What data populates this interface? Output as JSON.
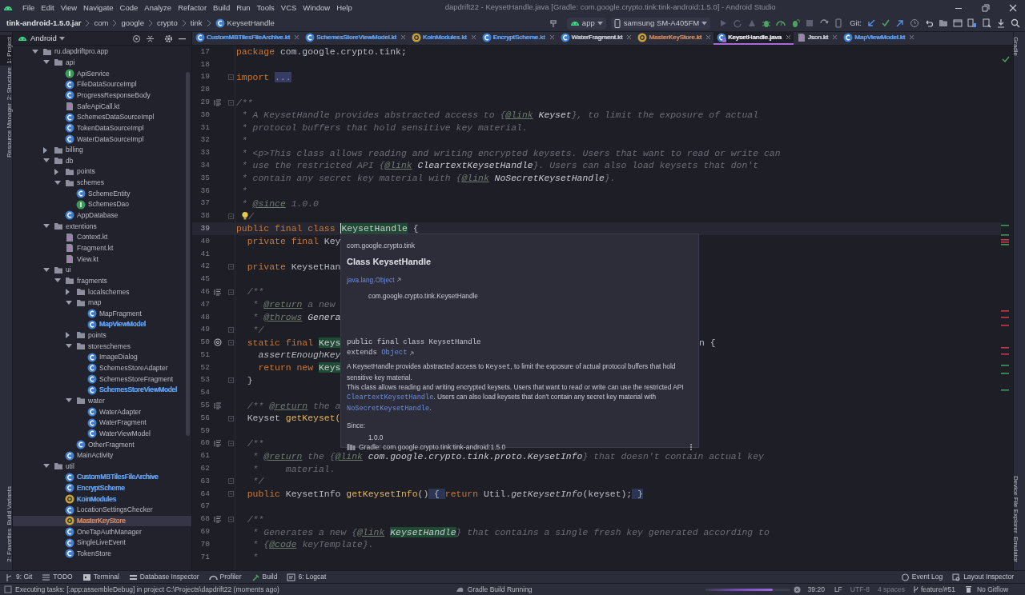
{
  "menu": [
    "File",
    "Edit",
    "View",
    "Navigate",
    "Code",
    "Analyze",
    "Refactor",
    "Build",
    "Run",
    "Tools",
    "VCS",
    "Window",
    "Help"
  ],
  "window_title": "dapdrift22 - KeysetHandle.java [Gradle: com.google.crypto.tink:tink-android:1.5.0] - Android Studio",
  "breadcrumbs": [
    {
      "label": "tink-android-1.5.0.jar",
      "kind": "jar"
    },
    {
      "label": "com",
      "kind": "package"
    },
    {
      "label": "google",
      "kind": "package"
    },
    {
      "label": "crypto",
      "kind": "package"
    },
    {
      "label": "tink",
      "kind": "package"
    },
    {
      "label": "KeysetHandle",
      "kind": "class"
    }
  ],
  "toolbar": {
    "run_config": "app",
    "device": "samsung SM-A405FM",
    "vcs_label": "Git:"
  },
  "left_strip": {
    "top": [
      {
        "label": "1: Project",
        "selected": true
      },
      {
        "label": "2: Structure",
        "selected": false
      },
      {
        "label": "Resource Manager",
        "selected": false
      }
    ],
    "bottom": [
      {
        "label": "Build Variants",
        "selected": false
      },
      {
        "label": "2: Favorites",
        "selected": false
      }
    ]
  },
  "right_strip": {
    "top": [
      {
        "label": "Gradle"
      }
    ],
    "bottom": [
      {
        "label": "Device File Explorer"
      },
      {
        "label": "Emulator"
      }
    ]
  },
  "project_panel": {
    "view": "Android",
    "tree": [
      {
        "label": "ru.dapdriftpro.app",
        "kind": "package",
        "expanded": true,
        "selected": false,
        "children": [
          {
            "label": "api",
            "kind": "package",
            "expanded": true,
            "selected": false,
            "children": [
              {
                "label": "ApiService",
                "kind": "interface",
                "selected": false
              },
              {
                "label": "FileDataSourceImpl",
                "kind": "class",
                "selected": false
              },
              {
                "label": "ProgressResponseBody",
                "kind": "class",
                "selected": false
              },
              {
                "label": "SafeApiCall.kt",
                "kind": "kotlin-file",
                "selected": false
              },
              {
                "label": "SchemesDataSourceImpl",
                "kind": "class",
                "selected": false
              },
              {
                "label": "TokenDataSourceImpl",
                "kind": "class",
                "selected": false
              },
              {
                "label": "WaterDataSourceImpl",
                "kind": "class",
                "selected": false
              }
            ]
          },
          {
            "label": "billing",
            "kind": "package",
            "expanded": false,
            "selected": false
          },
          {
            "label": "db",
            "kind": "package",
            "expanded": true,
            "selected": false,
            "children": [
              {
                "label": "points",
                "kind": "package",
                "expanded": false,
                "selected": false
              },
              {
                "label": "schemes",
                "kind": "package",
                "expanded": true,
                "selected": false,
                "children": [
                  {
                    "label": "SchemeEntity",
                    "kind": "class",
                    "selected": false
                  },
                  {
                    "label": "SchemesDao",
                    "kind": "interface",
                    "selected": false
                  }
                ]
              },
              {
                "label": "AppDatabase",
                "kind": "class",
                "selected": false
              }
            ]
          },
          {
            "label": "extentions",
            "kind": "package",
            "expanded": true,
            "selected": false,
            "children": [
              {
                "label": "Context.kt",
                "kind": "kotlin-file",
                "selected": false
              },
              {
                "label": "Fragment.kt",
                "kind": "kotlin-file",
                "selected": false
              },
              {
                "label": "View.kt",
                "kind": "kotlin-file",
                "selected": false
              }
            ]
          },
          {
            "label": "ui",
            "kind": "package",
            "expanded": true,
            "selected": false,
            "children": [
              {
                "label": "fragments",
                "kind": "package",
                "expanded": true,
                "selected": false,
                "children": [
                  {
                    "label": "localschemes",
                    "kind": "package",
                    "expanded": false,
                    "selected": false
                  },
                  {
                    "label": "map",
                    "kind": "package",
                    "expanded": true,
                    "selected": false,
                    "children": [
                      {
                        "label": "MapFragment",
                        "kind": "class",
                        "selected": false
                      },
                      {
                        "label": "MapViewModel",
                        "kind": "class",
                        "color": "#5e9ff0",
                        "selected": false
                      }
                    ]
                  },
                  {
                    "label": "points",
                    "kind": "package",
                    "expanded": false,
                    "selected": false
                  },
                  {
                    "label": "storeschemes",
                    "kind": "package",
                    "expanded": true,
                    "selected": false,
                    "children": [
                      {
                        "label": "ImageDialog",
                        "kind": "class",
                        "selected": false
                      },
                      {
                        "label": "SchemesStoreAdapter",
                        "kind": "class",
                        "selected": false
                      },
                      {
                        "label": "SchemesStoreFragment",
                        "kind": "class",
                        "selected": false
                      },
                      {
                        "label": "SchemesStoreViewModel",
                        "kind": "class",
                        "color": "#5e9ff0",
                        "selected": false
                      }
                    ]
                  },
                  {
                    "label": "water",
                    "kind": "package",
                    "expanded": true,
                    "selected": false,
                    "children": [
                      {
                        "label": "WaterAdapter",
                        "kind": "class",
                        "selected": false
                      },
                      {
                        "label": "WaterFragment",
                        "kind": "class",
                        "selected": false
                      },
                      {
                        "label": "WaterViewModel",
                        "kind": "class",
                        "selected": false
                      }
                    ]
                  },
                  {
                    "label": "OtherFragment",
                    "kind": "class",
                    "selected": false
                  }
                ]
              },
              {
                "label": "MainActivity",
                "kind": "class",
                "selected": false
              }
            ]
          },
          {
            "label": "util",
            "kind": "package",
            "expanded": true,
            "selected": false,
            "children": [
              {
                "label": "CustomMBTilesFileArchive",
                "kind": "class",
                "color": "#5e9ff0",
                "selected": false
              },
              {
                "label": "EncryptScheme",
                "kind": "class",
                "color": "#5e9ff0",
                "selected": false
              },
              {
                "label": "KoinModules",
                "kind": "object",
                "color": "#5e9ff0",
                "selected": false
              },
              {
                "label": "LocationSettingsChecker",
                "kind": "class",
                "selected": false
              },
              {
                "label": "MasterKeyStore",
                "kind": "object",
                "color": "#c8845c",
                "selected": true
              },
              {
                "label": "OneTapAuthManager",
                "kind": "class",
                "selected": false
              },
              {
                "label": "SingleLiveEvent",
                "kind": "class",
                "selected": false
              },
              {
                "label": "TokenStore",
                "kind": "class",
                "selected": false
              }
            ]
          }
        ]
      }
    ]
  },
  "editor_tabs": [
    {
      "label": "CustomMBTilesFileArchive.kt",
      "kind": "class",
      "color": "#5e9ff0",
      "selected": false
    },
    {
      "label": "SchemesStoreViewModel.kt",
      "kind": "class",
      "color": "#5e9ff0",
      "selected": false
    },
    {
      "label": "KoinModules.kt",
      "kind": "object",
      "color": "#5e9ff0",
      "selected": false
    },
    {
      "label": "EncryptScheme.kt",
      "kind": "class",
      "color": "#5e9ff0",
      "selected": false
    },
    {
      "label": "WaterFragment.kt",
      "kind": "class",
      "color": "#c5c8d0",
      "selected": false
    },
    {
      "label": "MasterKeyStore.kt",
      "kind": "object",
      "color": "#c8845c",
      "selected": false
    },
    {
      "label": "KeysetHandle.java",
      "kind": "java-class",
      "color": "#dfe1e6",
      "selected": true
    },
    {
      "label": "Json.kt",
      "kind": "kotlin-file",
      "color": "#c5c8d0",
      "selected": false
    },
    {
      "label": "MapViewModel.kt",
      "kind": "class",
      "color": "#5e9ff0",
      "selected": false
    }
  ],
  "editor": {
    "lines": [
      {
        "number": "17",
        "current": false,
        "segments": [
          {
            "kind": "kw",
            "text": "package"
          },
          {
            "kind": "plain",
            "text": " com.google.crypto.tink;"
          }
        ]
      },
      {
        "number": "18",
        "current": false
      },
      {
        "number": "19",
        "current": false,
        "fold": true,
        "segments": [
          {
            "kind": "kw",
            "text": "import "
          },
          {
            "kind": "folded",
            "text": "..."
          }
        ]
      },
      {
        "number": "28",
        "current": false
      },
      {
        "number": "29",
        "current": false,
        "doc_icon": true,
        "fold": true,
        "segments": [
          {
            "kind": "comment",
            "text": "/**"
          }
        ]
      },
      {
        "number": "30",
        "current": false,
        "segments": [
          {
            "kind": "comment",
            "text": " * A KeysetHandle provides abstracted access to {"
          },
          {
            "kind": "tag",
            "text": "@link"
          },
          {
            "kind": "ref",
            "text": " Keyset"
          },
          {
            "kind": "comment",
            "text": "}, to limit the exposure of actual"
          }
        ]
      },
      {
        "number": "31",
        "current": false,
        "segments": [
          {
            "kind": "comment",
            "text": " * protocol buffers that hold sensitive key material."
          }
        ]
      },
      {
        "number": "32",
        "current": false,
        "segments": [
          {
            "kind": "comment",
            "text": " *"
          }
        ]
      },
      {
        "number": "33",
        "current": false,
        "segments": [
          {
            "kind": "comment",
            "text": " * <p>This class allows reading and writing encrypted keysets. Users that want to read or write can"
          }
        ]
      },
      {
        "number": "34",
        "current": false,
        "segments": [
          {
            "kind": "comment",
            "text": " * use the restricted API {"
          },
          {
            "kind": "tag",
            "text": "@link"
          },
          {
            "kind": "ref",
            "text": " CleartextKeysetHandle"
          },
          {
            "kind": "comment",
            "text": "}. Users can also load keysets that don't"
          }
        ]
      },
      {
        "number": "35",
        "current": false,
        "segments": [
          {
            "kind": "comment",
            "text": " * contain any secret key material with {"
          },
          {
            "kind": "tag",
            "text": "@link"
          },
          {
            "kind": "ref",
            "text": " NoSecretKeysetHandle"
          },
          {
            "kind": "comment",
            "text": "}."
          }
        ]
      },
      {
        "number": "36",
        "current": false,
        "segments": [
          {
            "kind": "comment",
            "text": " *"
          }
        ]
      },
      {
        "number": "37",
        "current": false,
        "segments": [
          {
            "kind": "comment",
            "text": " * "
          },
          {
            "kind": "tag",
            "text": "@since"
          },
          {
            "kind": "comment",
            "text": " 1.0.0"
          }
        ]
      },
      {
        "number": "38",
        "current": false,
        "fold": true,
        "segments": [
          {
            "kind": "bulb"
          },
          {
            "kind": "comment",
            "text": "/"
          }
        ]
      },
      {
        "number": "39",
        "current": true,
        "segments": [
          {
            "kind": "kw",
            "text": "public final class "
          },
          {
            "kind": "hl",
            "text": "KeysetHandle",
            "caret": true
          },
          {
            "kind": "plain",
            "text": " {"
          }
        ]
      },
      {
        "number": "40",
        "current": false,
        "segments": [
          {
            "kind": "kw",
            "text": "  private final "
          },
          {
            "kind": "plain",
            "text": "Key"
          }
        ]
      },
      {
        "number": "41",
        "current": false
      },
      {
        "number": "42",
        "current": false,
        "fold": true,
        "segments": [
          {
            "kind": "kw",
            "text": "  private "
          },
          {
            "kind": "plain",
            "text": "KeysetHan"
          }
        ]
      },
      {
        "number": "45",
        "current": false
      },
      {
        "number": "46",
        "current": false,
        "doc_icon": true,
        "fold": true,
        "segments": [
          {
            "kind": "comment",
            "text": "  /**"
          }
        ]
      },
      {
        "number": "47",
        "current": false,
        "segments": [
          {
            "kind": "comment",
            "text": "   * "
          },
          {
            "kind": "tag",
            "text": "@return"
          },
          {
            "kind": "comment",
            "text": " a new"
          }
        ]
      },
      {
        "number": "48",
        "current": false,
        "segments": [
          {
            "kind": "comment",
            "text": "   * "
          },
          {
            "kind": "tag",
            "text": "@throws"
          },
          {
            "kind": "ref",
            "text": " Genera"
          }
        ]
      },
      {
        "number": "49",
        "current": false,
        "fold": true,
        "segments": [
          {
            "kind": "comment",
            "text": "   */"
          }
        ]
      },
      {
        "number": "50",
        "current": false,
        "override_icon": true,
        "fold": true,
        "segments": [
          {
            "kind": "kw",
            "text": "  static final "
          },
          {
            "kind": "hl",
            "text": "Keys"
          }
        ],
        "after_popup": [
          {
            "kind": "plain",
            "text": "n {"
          }
        ]
      },
      {
        "number": "51",
        "current": false,
        "segments": [
          {
            "kind": "ifn",
            "text": "    assertEnoughKey"
          }
        ]
      },
      {
        "number": "52",
        "current": false,
        "segments": [
          {
            "kind": "kw",
            "text": "    return new "
          },
          {
            "kind": "hl",
            "text": "Keys"
          }
        ]
      },
      {
        "number": "53",
        "current": false,
        "fold": true,
        "segments": [
          {
            "kind": "plain",
            "text": "  }"
          }
        ]
      },
      {
        "number": "54",
        "current": false
      },
      {
        "number": "55",
        "current": false,
        "doc_icon": true,
        "segments": [
          {
            "kind": "comment",
            "text": "  /** "
          },
          {
            "kind": "tag",
            "text": "@return"
          },
          {
            "kind": "comment",
            "text": " the a"
          }
        ]
      },
      {
        "number": "56",
        "current": false,
        "fold": true,
        "segments": [
          {
            "kind": "plain",
            "text": "  Keyset "
          },
          {
            "kind": "fn",
            "text": "getKeyset("
          }
        ]
      },
      {
        "number": "59",
        "current": false
      },
      {
        "number": "60",
        "current": false,
        "doc_icon": true,
        "fold": true,
        "segments": [
          {
            "kind": "comment",
            "text": "  /**"
          }
        ]
      },
      {
        "number": "61",
        "current": false,
        "segments": [
          {
            "kind": "comment",
            "text": "   * "
          },
          {
            "kind": "tag",
            "text": "@return"
          },
          {
            "kind": "comment",
            "text": " the {"
          },
          {
            "kind": "tag",
            "text": "@link"
          },
          {
            "kind": "ref",
            "text": " com.google.crypto.tink.proto.KeysetInfo"
          },
          {
            "kind": "comment",
            "text": "} that doesn't contain actual key"
          }
        ]
      },
      {
        "number": "62",
        "current": false,
        "segments": [
          {
            "kind": "comment",
            "text": "   *     material."
          }
        ]
      },
      {
        "number": "63",
        "current": false,
        "fold": true,
        "segments": [
          {
            "kind": "comment",
            "text": "   */"
          }
        ]
      },
      {
        "number": "64",
        "current": false,
        "fold": true,
        "segments": [
          {
            "kind": "kw",
            "text": "  public "
          },
          {
            "kind": "plain",
            "text": "KeysetInfo "
          },
          {
            "kind": "fn",
            "text": "getKeysetInfo"
          },
          {
            "kind": "plain",
            "text": "()"
          },
          {
            "kind": "brace",
            "text": " { "
          },
          {
            "kind": "kw",
            "text": "return "
          },
          {
            "kind": "plain",
            "text": "Util."
          },
          {
            "kind": "ifn",
            "text": "getKeysetInfo"
          },
          {
            "kind": "plain",
            "text": "(keyset);"
          },
          {
            "kind": "brace",
            "text": " }"
          }
        ]
      },
      {
        "number": "67",
        "current": false
      },
      {
        "number": "68",
        "current": false,
        "doc_icon": true,
        "fold": true,
        "segments": [
          {
            "kind": "comment",
            "text": "  /**"
          }
        ]
      },
      {
        "number": "69",
        "current": false,
        "segments": [
          {
            "kind": "comment",
            "text": "   * Generates a new {"
          },
          {
            "kind": "tag",
            "text": "@link"
          },
          {
            "kind": "hlref",
            "text": "KeysetHandle"
          },
          {
            "kind": "comment",
            "text": "} that contains a single fresh key generated according to"
          }
        ]
      },
      {
        "number": "70",
        "current": false,
        "segments": [
          {
            "kind": "comment",
            "text": "   * {"
          },
          {
            "kind": "tag",
            "text": "@code"
          },
          {
            "kind": "comment",
            "text": " keyTemplate}."
          }
        ]
      },
      {
        "number": "71",
        "current": false,
        "segments": [
          {
            "kind": "comment",
            "text": "   *"
          }
        ]
      }
    ]
  },
  "doc_popup": {
    "package": "com.google.crypto.tink",
    "title": "Class KeysetHandle",
    "hierarchy": [
      {
        "text": "java.lang.Object",
        "link": true
      },
      {
        "text": "com.google.crypto.tink.KeysetHandle",
        "link": false
      }
    ],
    "signature": [
      [
        {
          "kind": "code",
          "text": "public final class KeysetHandle"
        }
      ],
      [
        {
          "kind": "code",
          "text": "extends "
        },
        {
          "kind": "code-link",
          "text": "Object"
        }
      ]
    ],
    "paragraphs": [
      [
        {
          "kind": "text",
          "text": "A KeysetHandle provides abstracted access to "
        },
        {
          "kind": "code",
          "text": "Keyset"
        },
        {
          "kind": "text",
          "text": ", to limit the exposure of actual protocol buffers that hold sensitive key material."
        }
      ],
      [
        {
          "kind": "text",
          "text": "This class allows reading and writing encrypted keysets. Users that want to read or write can use the restricted API "
        },
        {
          "kind": "code-link",
          "text": "CleartextKeysetHandle"
        },
        {
          "kind": "text",
          "text": ". Users can also load keysets that don't contain any secret key material with "
        },
        {
          "kind": "code-link",
          "text": "NoSecretKeysetHandle"
        },
        {
          "kind": "text",
          "text": "."
        }
      ]
    ],
    "since_label": "Since:",
    "since": "1.0.0",
    "source": "Gradle: com.google.crypto.tink:tink-android:1.5.0"
  },
  "tool_windows": {
    "left": [
      "9: Git",
      "TODO",
      "Terminal",
      "Database Inspector",
      "Profiler",
      "Build",
      "6: Logcat"
    ],
    "right": [
      "Event Log",
      "Layout Inspector"
    ]
  },
  "status_bar": {
    "message": "Executing tasks: [:app:assembleDebug] in project C:\\Projects\\dapdrift22 (moments ago)",
    "task": "Gradle Build Running",
    "level": 0.8,
    "position": "39:20",
    "line_separator": "LF",
    "encoding": "UTF-8",
    "indent": "4 spaces",
    "branch": "feature/#51",
    "gitflow": "No Gitflow"
  }
}
